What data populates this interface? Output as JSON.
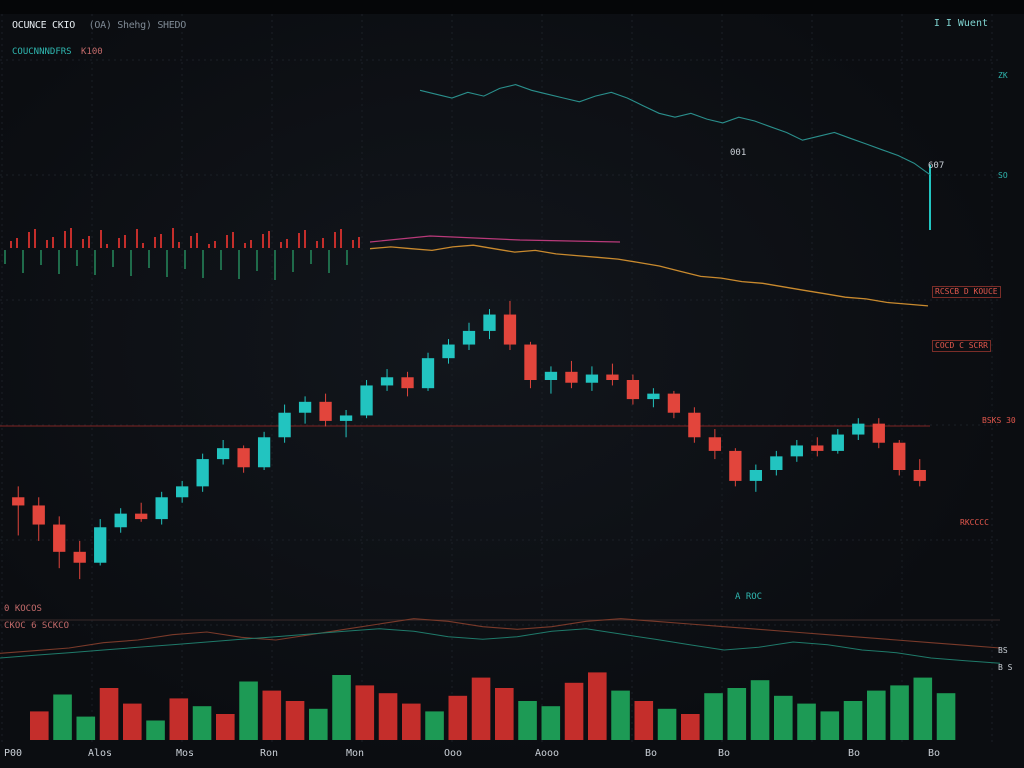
{
  "header": {
    "symbol": "OCUNCE CKIO",
    "meta": "(OA) Shehg) SHEDO",
    "sub_label": "COUCNNNDFRS",
    "sub_value": "K100",
    "corner_label": "I I Wuent"
  },
  "labels": {
    "upper_a": "001",
    "upper_b": "607",
    "right_a": "SO",
    "right_b": "ZK",
    "right_c": "BS",
    "right_d": "B S",
    "vol": "0 KOCOS",
    "ind": "CKOC 6 SCKCO",
    "ind_val": "A ROC",
    "tag1": "RCSCB D KOUCE",
    "tag2": "COCD C SCRR",
    "tag3": "BSKS 30",
    "tag4": "RKCCCC"
  },
  "colors": {
    "up": "#22c4c0",
    "down": "#e2453c",
    "vol_up": "#1d9a55",
    "vol_down": "#c42e2b",
    "upper_line": "#2a8f8c",
    "orange_line": "#c98a2e",
    "magenta_line": "#b93a7a",
    "grid": "#1b2027",
    "hline": "#6a2020"
  },
  "chart_data": {
    "type": "candlestick",
    "title": "OCUNCE CKIO",
    "x_ticks": [
      "P00",
      "Alos",
      "Mos",
      "Ron",
      "Mon",
      "Ooo",
      "Aooo",
      "Bo",
      "Bo",
      "Bo",
      "Bo"
    ],
    "grid": true,
    "price_range": [
      0,
      100
    ],
    "candles": [
      {
        "o": 74,
        "h": 78,
        "l": 60,
        "c": 71
      },
      {
        "o": 71,
        "h": 74,
        "l": 58,
        "c": 64
      },
      {
        "o": 64,
        "h": 67,
        "l": 48,
        "c": 54
      },
      {
        "o": 54,
        "h": 58,
        "l": 44,
        "c": 50
      },
      {
        "o": 50,
        "h": 66,
        "l": 49,
        "c": 63
      },
      {
        "o": 63,
        "h": 70,
        "l": 61,
        "c": 68
      },
      {
        "o": 68,
        "h": 72,
        "l": 65,
        "c": 66
      },
      {
        "o": 66,
        "h": 76,
        "l": 64,
        "c": 74
      },
      {
        "o": 74,
        "h": 80,
        "l": 72,
        "c": 78
      },
      {
        "o": 78,
        "h": 90,
        "l": 76,
        "c": 88
      },
      {
        "o": 88,
        "h": 95,
        "l": 86,
        "c": 92
      },
      {
        "o": 92,
        "h": 93,
        "l": 83,
        "c": 85
      },
      {
        "o": 85,
        "h": 98,
        "l": 84,
        "c": 96
      },
      {
        "o": 96,
        "h": 108,
        "l": 94,
        "c": 105
      },
      {
        "o": 105,
        "h": 111,
        "l": 101,
        "c": 109
      },
      {
        "o": 109,
        "h": 112,
        "l": 100,
        "c": 102
      },
      {
        "o": 102,
        "h": 106,
        "l": 96,
        "c": 104
      },
      {
        "o": 104,
        "h": 117,
        "l": 103,
        "c": 115
      },
      {
        "o": 115,
        "h": 121,
        "l": 113,
        "c": 118
      },
      {
        "o": 118,
        "h": 120,
        "l": 111,
        "c": 114
      },
      {
        "o": 114,
        "h": 127,
        "l": 113,
        "c": 125
      },
      {
        "o": 125,
        "h": 132,
        "l": 123,
        "c": 130
      },
      {
        "o": 130,
        "h": 138,
        "l": 128,
        "c": 135
      },
      {
        "o": 135,
        "h": 143,
        "l": 132,
        "c": 141
      },
      {
        "o": 141,
        "h": 146,
        "l": 128,
        "c": 130
      },
      {
        "o": 130,
        "h": 131,
        "l": 114,
        "c": 117
      },
      {
        "o": 117,
        "h": 122,
        "l": 112,
        "c": 120
      },
      {
        "o": 120,
        "h": 124,
        "l": 114,
        "c": 116
      },
      {
        "o": 116,
        "h": 122,
        "l": 113,
        "c": 119
      },
      {
        "o": 119,
        "h": 123,
        "l": 115,
        "c": 117
      },
      {
        "o": 117,
        "h": 119,
        "l": 108,
        "c": 110
      },
      {
        "o": 110,
        "h": 114,
        "l": 107,
        "c": 112
      },
      {
        "o": 112,
        "h": 113,
        "l": 103,
        "c": 105
      },
      {
        "o": 105,
        "h": 107,
        "l": 94,
        "c": 96
      },
      {
        "o": 96,
        "h": 99,
        "l": 88,
        "c": 91
      },
      {
        "o": 91,
        "h": 92,
        "l": 78,
        "c": 80
      },
      {
        "o": 80,
        "h": 86,
        "l": 76,
        "c": 84
      },
      {
        "o": 84,
        "h": 91,
        "l": 82,
        "c": 89
      },
      {
        "o": 89,
        "h": 95,
        "l": 87,
        "c": 93
      },
      {
        "o": 93,
        "h": 96,
        "l": 89,
        "c": 91
      },
      {
        "o": 91,
        "h": 99,
        "l": 90,
        "c": 97
      },
      {
        "o": 97,
        "h": 103,
        "l": 95,
        "c": 101
      },
      {
        "o": 101,
        "h": 103,
        "l": 92,
        "c": 94
      },
      {
        "o": 94,
        "h": 95,
        "l": 82,
        "c": 84
      },
      {
        "o": 84,
        "h": 88,
        "l": 78,
        "c": 80
      }
    ],
    "upper_line": [
      172,
      170,
      168,
      171,
      169,
      173,
      175,
      172,
      170,
      168,
      166,
      169,
      171,
      168,
      164,
      160,
      158,
      160,
      157,
      155,
      158,
      156,
      153,
      150,
      146,
      148,
      150,
      147,
      144,
      141,
      138,
      134,
      128
    ],
    "orange_line": [
      130,
      131,
      130,
      129,
      131,
      132,
      130,
      128,
      129,
      127,
      126,
      125,
      124,
      122,
      120,
      117,
      114,
      113,
      111,
      110,
      108,
      106,
      104,
      102,
      101,
      99,
      98,
      97
    ],
    "volume": [
      22,
      35,
      18,
      40,
      28,
      15,
      32,
      26,
      20,
      45,
      38,
      30,
      24,
      50,
      42,
      36,
      28,
      22,
      34,
      48,
      40,
      30,
      26,
      44,
      52,
      38,
      30,
      24,
      20,
      36,
      40,
      46,
      34,
      28,
      22,
      30,
      38,
      42,
      48,
      36
    ],
    "indicator_line": [
      20,
      22,
      24,
      28,
      30,
      34,
      36,
      32,
      30,
      34,
      38,
      42,
      46,
      44,
      40,
      38,
      40,
      44,
      46,
      44,
      42,
      40,
      38,
      36,
      34,
      32,
      30,
      28,
      26,
      24
    ]
  }
}
